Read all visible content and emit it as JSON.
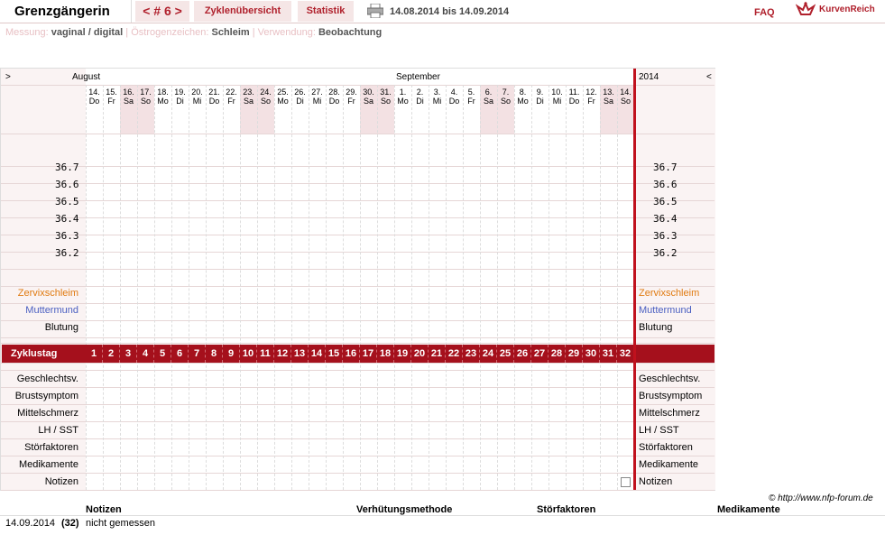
{
  "header": {
    "title": "Grenzgängerin",
    "cycle_label": "< # 6 >",
    "tab_overview": "Zyklenübersicht",
    "tab_stats": "Statistik",
    "date_range": "14.08.2014 bis 14.09.2014",
    "faq": "FAQ",
    "logo_text": "KurvenReich"
  },
  "settings": {
    "messung_label": "Messung:",
    "messung_value": "vaginal / digital",
    "sep1": "|",
    "oestrogen_label": "Östrogenzeichen:",
    "oestrogen_value": "Schleim",
    "sep2": "|",
    "verwendung_label": "Verwendung:",
    "verwendung_value": "Beobachtung"
  },
  "chart": {
    "nav_left": ">",
    "nav_right": "<",
    "month_aug": "August",
    "month_sep": "September",
    "year": "2014",
    "days": [
      {
        "d": "14.",
        "w": "Do"
      },
      {
        "d": "15.",
        "w": "Fr"
      },
      {
        "d": "16.",
        "w": "Sa"
      },
      {
        "d": "17.",
        "w": "So"
      },
      {
        "d": "18.",
        "w": "Mo"
      },
      {
        "d": "19.",
        "w": "Di"
      },
      {
        "d": "20.",
        "w": "Mi"
      },
      {
        "d": "21.",
        "w": "Do"
      },
      {
        "d": "22.",
        "w": "Fr"
      },
      {
        "d": "23.",
        "w": "Sa"
      },
      {
        "d": "24.",
        "w": "So"
      },
      {
        "d": "25.",
        "w": "Mo"
      },
      {
        "d": "26.",
        "w": "Di"
      },
      {
        "d": "27.",
        "w": "Mi"
      },
      {
        "d": "28.",
        "w": "Do"
      },
      {
        "d": "29.",
        "w": "Fr"
      },
      {
        "d": "30.",
        "w": "Sa"
      },
      {
        "d": "31.",
        "w": "So"
      },
      {
        "d": "1.",
        "w": "Mo"
      },
      {
        "d": "2.",
        "w": "Di"
      },
      {
        "d": "3.",
        "w": "Mi"
      },
      {
        "d": "4.",
        "w": "Do"
      },
      {
        "d": "5.",
        "w": "Fr"
      },
      {
        "d": "6.",
        "w": "Sa"
      },
      {
        "d": "7.",
        "w": "So"
      },
      {
        "d": "8.",
        "w": "Mo"
      },
      {
        "d": "9.",
        "w": "Di"
      },
      {
        "d": "10.",
        "w": "Mi"
      },
      {
        "d": "11.",
        "w": "Do"
      },
      {
        "d": "12.",
        "w": "Fr"
      },
      {
        "d": "13.",
        "w": "Sa"
      },
      {
        "d": "14.",
        "w": "So"
      }
    ],
    "temps": [
      "36.7",
      "36.6",
      "36.5",
      "36.4",
      "36.3",
      "36.2"
    ],
    "row_zervix": "Zervixschleim",
    "row_muttermund": "Muttermund",
    "row_blutung": "Blutung",
    "zyklustag_label": "Zyklustag",
    "zyklustage": [
      "1",
      "2",
      "3",
      "4",
      "5",
      "6",
      "7",
      "8",
      "9",
      "10",
      "11",
      "12",
      "13",
      "14",
      "15",
      "16",
      "17",
      "18",
      "19",
      "20",
      "21",
      "22",
      "23",
      "24",
      "25",
      "26",
      "27",
      "28",
      "29",
      "30",
      "31",
      "32"
    ],
    "rows_lower": [
      "Geschlechtsv.",
      "Brustsymptom",
      "Mittelschmerz",
      "LH / SST",
      "Störfaktoren",
      "Medikamente",
      "Notizen"
    ],
    "colors": {
      "accent": "#b0202c",
      "zervix": "#e07a10",
      "muttermund": "#4a5fc1"
    }
  },
  "footer": {
    "copyright": "© http://www.nfp-forum.de",
    "col_notizen": "Notizen",
    "col_verhuetung": "Verhütungsmethode",
    "col_stoer": "Störfaktoren",
    "col_medi": "Medikamente",
    "entry_date": "14.09.2014",
    "entry_day": "(32)",
    "entry_note": "nicht gemessen"
  }
}
